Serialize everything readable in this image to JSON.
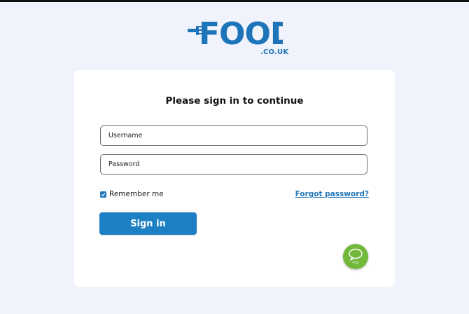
{
  "brand": {
    "name": "FOOD",
    "tld": ".CO.UK",
    "color": "#1e74b8"
  },
  "form": {
    "title": "Please sign in to continue",
    "username_placeholder": "Username",
    "password_placeholder": "Password",
    "remember_label": "Remember me",
    "remember_checked": true,
    "forgot_label": "Forgot password?",
    "signin_label": "Sign in"
  },
  "chat": {
    "label": "Chat",
    "color": "#72b83a",
    "icon": "chat-bubble-icon"
  },
  "colors": {
    "accent": "#1e80c4",
    "page_bg": "#f0f3fb"
  }
}
